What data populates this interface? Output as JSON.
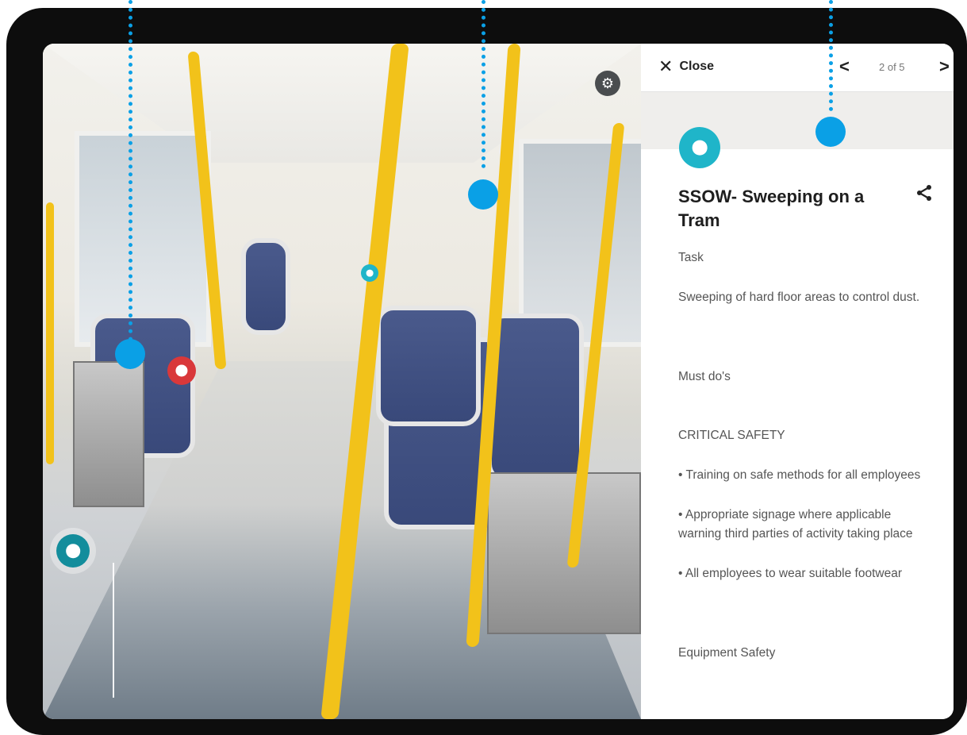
{
  "panel": {
    "close_label": "Close",
    "pager": "2 of 5",
    "title": "SSOW- Sweeping on a Tram",
    "sections": {
      "task_heading": "Task",
      "task_text": "Sweeping of hard floor areas to control dust.",
      "must_do": "Must do's",
      "critical": "CRITICAL SAFETY",
      "bullet1": "• Training on safe methods for all employees",
      "bullet2": "• Appropriate signage where applicable warning third parties of activity taking place",
      "bullet3": "• All employees to wear suitable footwear",
      "equipment": "Equipment Safety"
    }
  },
  "colors": {
    "tag_teal": "#1fb5c9",
    "tag_red": "#d9383a",
    "callout_blue": "#0aa0e6",
    "pole_yellow": "#f2c21a"
  },
  "icons": {
    "close": "close-icon",
    "prev": "chevron-left-icon",
    "next": "chevron-right-icon",
    "share": "share-icon",
    "settings": "gear-icon"
  }
}
